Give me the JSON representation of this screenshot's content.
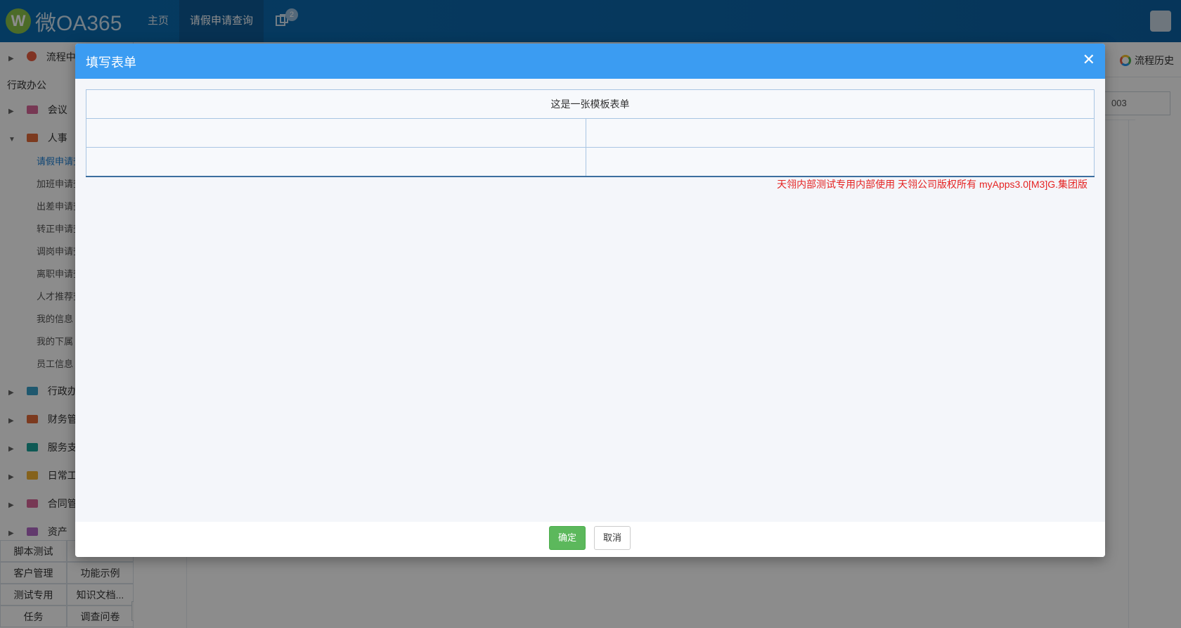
{
  "topbar": {
    "logo_letter": "W",
    "logo_text": "微OA365",
    "nav": [
      "主页",
      "请假申请查询"
    ],
    "notification_count": "2"
  },
  "sidebar": {
    "flow_center": "流程中心",
    "section": "行政办公",
    "groups": [
      {
        "label": "会议",
        "color": "#d9669a",
        "expanded": false
      },
      {
        "label": "人事",
        "color": "#e26b3a",
        "expanded": true
      }
    ],
    "hr_items": [
      "请假申请查询",
      "加班申请查询",
      "出差申请查询",
      "转正申请查询",
      "调岗申请查询",
      "离职申请查询",
      "人才推荐查询",
      "我的信息",
      "我的下属",
      "员工信息"
    ],
    "more_groups": [
      {
        "label": "行政办公",
        "color": "#3aa0c8"
      },
      {
        "label": "财务管理",
        "color": "#e26b3a"
      },
      {
        "label": "服务支持",
        "color": "#1aa39a"
      },
      {
        "label": "日常工作",
        "color": "#f2b233"
      },
      {
        "label": "合同管理",
        "color": "#d9669a"
      },
      {
        "label": "资产",
        "color": "#b26bc6"
      }
    ],
    "quick_links": [
      "脚本测试",
      "",
      "客户管理",
      "功能示例",
      "测试专用",
      "知识文档...",
      "任务",
      "调查问卷"
    ]
  },
  "main": {
    "flow_history": "流程历史",
    "search_value": "003"
  },
  "modal": {
    "title": "填写表单",
    "form_title": "这是一张模板表单",
    "copyright": "天翎内部测试专用内部使用 天翎公司版权所有 myApps3.0[M3]G.集团版",
    "ok_label": "确定",
    "cancel_label": "取消"
  },
  "colors": {
    "topbar": "#0a6bb0",
    "modal_header": "#3b9cf2",
    "ok_button": "#5cb85c",
    "copyright_text": "#e52322"
  }
}
